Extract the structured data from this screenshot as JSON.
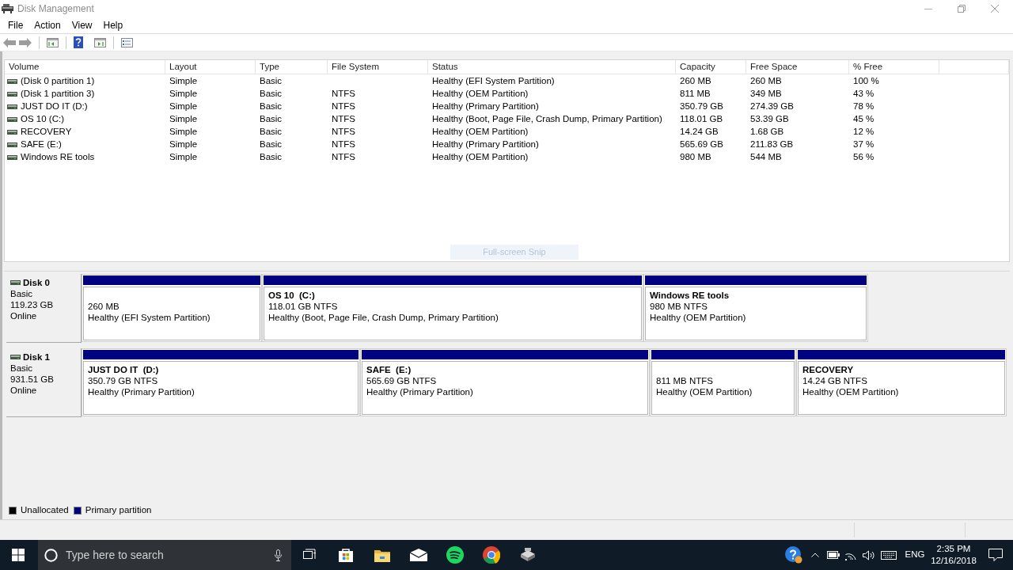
{
  "window": {
    "title": "Disk Management"
  },
  "menu": [
    "File",
    "Action",
    "View",
    "Help"
  ],
  "volume_table": {
    "columns": [
      "Volume",
      "Layout",
      "Type",
      "File System",
      "Status",
      "Capacity",
      "Free Space",
      "% Free"
    ],
    "rows": [
      {
        "volume": "(Disk 0 partition 1)",
        "layout": "Simple",
        "type": "Basic",
        "status": "Healthy (EFI System Partition)",
        "capacity": "260 MB",
        "free_space": "260 MB",
        "percent_free": "100 %"
      },
      {
        "volume": "(Disk 1 partition 3)",
        "layout": "Simple",
        "type": "Basic",
        "file_system": "NTFS",
        "status": "Healthy (OEM Partition)",
        "capacity": "811 MB",
        "free_space": "349 MB",
        "percent_free": "43 %"
      },
      {
        "volume": "JUST DO IT (D:)",
        "layout": "Simple",
        "type": "Basic",
        "file_system": "NTFS",
        "status": "Healthy (Primary Partition)",
        "capacity": "350.79 GB",
        "free_space": "274.39 GB",
        "percent_free": "78 %"
      },
      {
        "volume": "OS 10 (C:)",
        "layout": "Simple",
        "type": "Basic",
        "file_system": "NTFS",
        "status": "Healthy (Boot, Page File, Crash Dump, Primary Partition)",
        "capacity": "118.01 GB",
        "free_space": "53.39 GB",
        "percent_free": "45 %"
      },
      {
        "volume": "RECOVERY",
        "layout": "Simple",
        "type": "Basic",
        "file_system": "NTFS",
        "status": "Healthy (OEM Partition)",
        "capacity": "14.24 GB",
        "free_space": "1.68 GB",
        "percent_free": "12 %"
      },
      {
        "volume": "SAFE (E:)",
        "layout": "Simple",
        "type": "Basic",
        "file_system": "NTFS",
        "status": "Healthy (Primary Partition)",
        "capacity": "565.69 GB",
        "free_space": "211.83 GB",
        "percent_free": "37 %"
      },
      {
        "volume": "Windows RE tools",
        "layout": "Simple",
        "type": "Basic",
        "file_system": "NTFS",
        "status": "Healthy (OEM Partition)",
        "capacity": "980 MB",
        "free_space": "544 MB",
        "percent_free": "56 %"
      }
    ]
  },
  "snip_tooltip": "Full-screen Snip",
  "disks": [
    {
      "name": "Disk 0",
      "type": "Basic",
      "size": "119.23 GB",
      "state": "Online",
      "partitions": [
        {
          "size": "260 MB",
          "status": "Healthy (EFI System Partition)"
        },
        {
          "name": "OS 10  (C:)",
          "size": "118.01 GB NTFS",
          "status": "Healthy (Boot, Page File, Crash Dump, Primary Partition)"
        },
        {
          "name": "Windows RE tools",
          "size": "980 MB NTFS",
          "status": "Healthy (OEM Partition)"
        }
      ]
    },
    {
      "name": "Disk 1",
      "type": "Basic",
      "size": "931.51 GB",
      "state": "Online",
      "partitions": [
        {
          "name": "JUST DO IT  (D:)",
          "size": "350.79 GB NTFS",
          "status": "Healthy (Primary Partition)"
        },
        {
          "name": "SAFE  (E:)",
          "size": "565.69 GB NTFS",
          "status": "Healthy (Primary Partition)"
        },
        {
          "size": "811 MB NTFS",
          "status": "Healthy (OEM Partition)"
        },
        {
          "name": "RECOVERY",
          "size": "14.24 GB NTFS",
          "status": "Healthy (OEM Partition)"
        }
      ]
    }
  ],
  "legend": [
    {
      "label": "Unallocated",
      "color": "#000000"
    },
    {
      "label": "Primary partition",
      "color": "#000080"
    }
  ],
  "taskbar": {
    "search": {
      "placeholder": "Type here to search"
    },
    "language": "ENG",
    "time": "2:35 PM",
    "date": "12/16/2018"
  }
}
